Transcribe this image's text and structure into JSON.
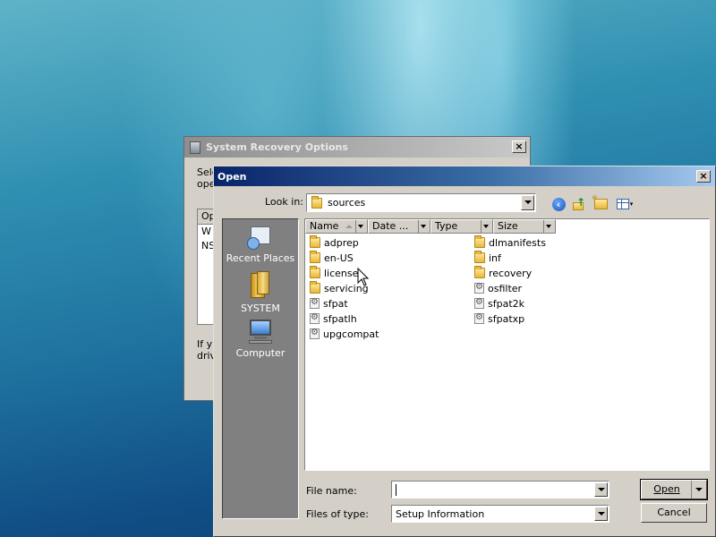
{
  "background_dialog": {
    "title": "System Recovery Options",
    "text_line1": "Sele",
    "text_line2": "ope",
    "list_header": "Op",
    "list_item1": "W",
    "list_item2": "NS",
    "footer_line1": "If y",
    "footer_line2": "driv",
    "close_label": "×"
  },
  "open_dialog": {
    "title": "Open",
    "close_label": "×",
    "look_in_label": "Look in:",
    "look_in_value": "sources",
    "back_glyph": "‹",
    "up_glyph": "↑",
    "views_glyph": "▾",
    "places": [
      {
        "label": "Recent Places"
      },
      {
        "label": "SYSTEM"
      },
      {
        "label": "Computer"
      }
    ],
    "columns": [
      "Name",
      "Date ...",
      "Type",
      "Size"
    ],
    "files_col1": [
      {
        "name": "adprep",
        "kind": "folder"
      },
      {
        "name": "en-US",
        "kind": "folder"
      },
      {
        "name": "license",
        "kind": "folder"
      },
      {
        "name": "servicing",
        "kind": "folder"
      },
      {
        "name": "sfpat",
        "kind": "file"
      },
      {
        "name": "sfpatlh",
        "kind": "file"
      },
      {
        "name": "upgcompat",
        "kind": "file"
      }
    ],
    "files_col2": [
      {
        "name": "dlmanifests",
        "kind": "folder"
      },
      {
        "name": "inf",
        "kind": "folder"
      },
      {
        "name": "recovery",
        "kind": "folder"
      },
      {
        "name": "osfilter",
        "kind": "file"
      },
      {
        "name": "sfpat2k",
        "kind": "file"
      },
      {
        "name": "sfpatxp",
        "kind": "file"
      }
    ],
    "file_name_label": "File name:",
    "file_name_value": "",
    "file_type_label": "Files of type:",
    "file_type_value": "Setup Information",
    "open_button": "Open",
    "cancel_button": "Cancel"
  }
}
